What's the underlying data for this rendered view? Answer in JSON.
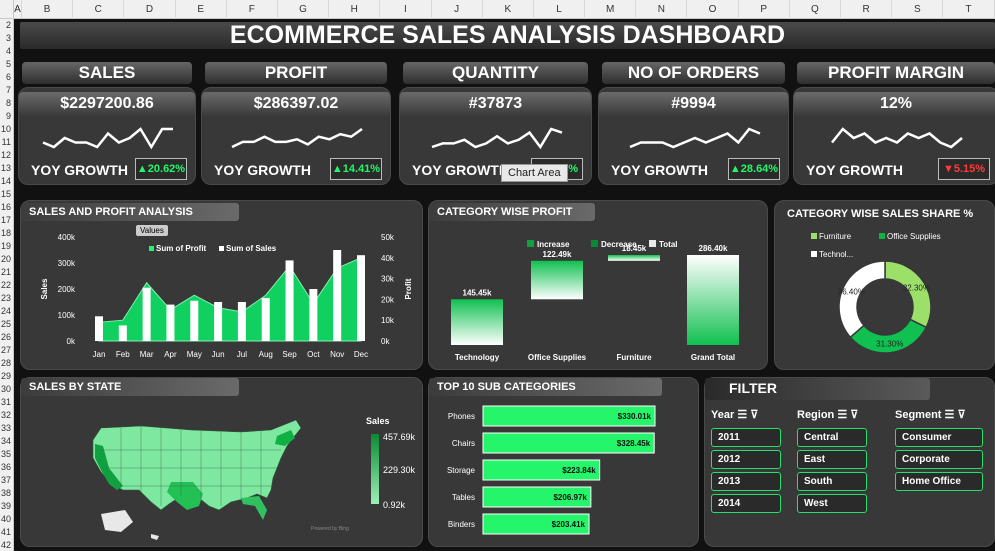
{
  "columns": [
    "A",
    "B",
    "C",
    "D",
    "E",
    "F",
    "G",
    "H",
    "I",
    "J",
    "K",
    "L",
    "M",
    "N",
    "O",
    "P",
    "Q",
    "R",
    "S",
    "T"
  ],
  "rows": [
    "2",
    "3",
    "4",
    "5",
    "6",
    "7",
    "8",
    "9",
    "10",
    "11",
    "12",
    "13",
    "14",
    "15",
    "16",
    "17",
    "18",
    "19",
    "20",
    "21",
    "22",
    "23",
    "24",
    "25",
    "26",
    "27",
    "28",
    "29",
    "30",
    "31",
    "32",
    "33",
    "34",
    "35",
    "36",
    "37",
    "38",
    "39",
    "40",
    "41",
    "42"
  ],
  "title": "ECOMMERCE SALES ANALYSIS DASHBOARD",
  "kpis": [
    {
      "label": "SALES",
      "value": "$2297200.86",
      "yoy": "YOY GROWTH",
      "growth": "▲20.62%",
      "up": true,
      "spark": [
        6,
        5,
        7,
        6,
        6,
        5,
        8,
        6,
        7,
        9,
        5,
        9,
        9
      ]
    },
    {
      "label": "PROFIT",
      "value": "$286397.02",
      "yoy": "YOY GROWTH",
      "growth": "▲14.41%",
      "up": true,
      "spark": [
        3,
        5,
        5,
        7,
        5,
        5,
        6,
        4,
        7,
        6,
        8,
        7,
        10
      ]
    },
    {
      "label": "QUANTITY",
      "value": "#37873",
      "yoy": "YOY GROWTH",
      "growth": "▲14.4%",
      "up": true,
      "spark": [
        4,
        5,
        5,
        6,
        4,
        5,
        7,
        5,
        6,
        8,
        4,
        9,
        8
      ]
    },
    {
      "label": "NO OF ORDERS",
      "value": "#9994",
      "yoy": "YOY GROWTH",
      "growth": "▲28.64%",
      "up": true,
      "spark": [
        5,
        6,
        6,
        6,
        5,
        6,
        7,
        6,
        7,
        8,
        6,
        9,
        8
      ]
    },
    {
      "label": "PROFIT MARGIN",
      "value": "12%",
      "yoy": "YOY GROWTH",
      "growth": "▼5.15%",
      "up": false,
      "spark": [
        6,
        9,
        7,
        8,
        6,
        7,
        6,
        8,
        7,
        8,
        6,
        5,
        7
      ]
    }
  ],
  "tooltip": "Chart Area",
  "colors": {
    "green": "#10d060",
    "bright": "#25f56b",
    "down": "#ff3b3b",
    "panel": "#383838"
  },
  "sales_profit": {
    "title": "SALES AND PROFIT ANALYSIS",
    "values_btn": "Values",
    "legend": [
      "Sum of Profit",
      "Sum of Sales"
    ],
    "ylabel_left": "Sales",
    "ylabel_right": "Profit",
    "left_ticks": [
      "400k",
      "300k",
      "200k",
      "100k",
      "0k"
    ],
    "right_ticks": [
      "50k",
      "40k",
      "30k",
      "20k",
      "10k",
      "0k"
    ]
  },
  "category_profit": {
    "title": "CATEGORY WISE PROFIT",
    "legend": [
      "Increase",
      "Decrease",
      "Total"
    ]
  },
  "sales_share": {
    "title": "CATEGORY WISE SALES SHARE %",
    "legend": [
      "Furniture",
      "Office Supplies",
      "Technol..."
    ]
  },
  "state": {
    "title": "SALES BY STATE",
    "legend_title": "Sales",
    "legend_vals": [
      "457.69k",
      "229.30k",
      "0.92k"
    ],
    "credit": "Powered by Bing"
  },
  "subcats": {
    "title": "TOP 10 SUB CATEGORIES"
  },
  "filter": {
    "title": "FILTER",
    "year_label": "Year",
    "region_label": "Region",
    "segment_label": "Segment",
    "years": [
      "2011",
      "2012",
      "2013",
      "2014"
    ],
    "regions": [
      "Central",
      "East",
      "South",
      "West"
    ],
    "segments": [
      "Consumer",
      "Corporate",
      "Home Office"
    ]
  },
  "chart_data": [
    {
      "type": "bar",
      "title": "SALES AND PROFIT ANALYSIS",
      "categories": [
        "Jan",
        "Feb",
        "Mar",
        "Apr",
        "May",
        "Jun",
        "Jul",
        "Aug",
        "Sep",
        "Oct",
        "Nov",
        "Dec"
      ],
      "series": [
        {
          "name": "Sum of Sales",
          "values": [
            95000,
            60000,
            205000,
            140000,
            155000,
            150000,
            150000,
            165000,
            310000,
            200000,
            350000,
            330000
          ]
        },
        {
          "name": "Sum of Profit",
          "values": [
            9000,
            10000,
            28000,
            15000,
            22000,
            16000,
            14000,
            22000,
            36000,
            18000,
            35000,
            40000
          ]
        }
      ],
      "ylim": [
        0,
        400000
      ],
      "ylim_right": [
        0,
        50000
      ]
    },
    {
      "type": "bar",
      "title": "CATEGORY WISE PROFIT",
      "categories": [
        "Technology",
        "Office Supplies",
        "Furniture",
        "Grand Total"
      ],
      "values": [
        145450,
        122490,
        18450,
        286400
      ],
      "labels": [
        "145.45k",
        "122.49k",
        "18.45k",
        "286.40k"
      ]
    },
    {
      "type": "pie",
      "title": "CATEGORY WISE SALES SHARE %",
      "categories": [
        "Furniture",
        "Office Supplies",
        "Technology"
      ],
      "values": [
        32.3,
        31.3,
        36.4
      ],
      "labels": [
        "32.30%",
        "31.30%",
        "36.40%"
      ]
    },
    {
      "type": "bar",
      "title": "TOP 10 SUB CATEGORIES",
      "categories": [
        "Phones",
        "Chairs",
        "Storage",
        "Tables",
        "Binders"
      ],
      "values": [
        330010,
        328450,
        223840,
        206970,
        203410
      ],
      "labels": [
        "$330.01k",
        "$328.45k",
        "$223.84k",
        "$206.97k",
        "$203.41k"
      ]
    }
  ]
}
